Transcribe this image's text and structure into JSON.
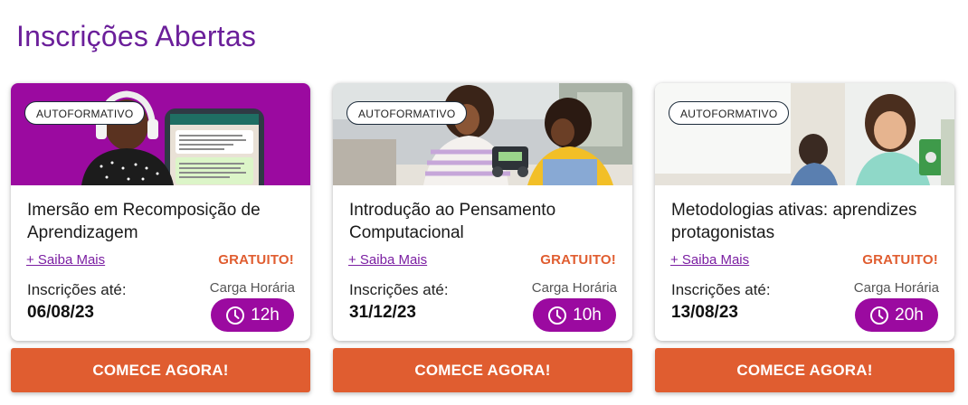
{
  "section": {
    "title": "Inscrições Abertas"
  },
  "colors": {
    "title": "#6b1f9a",
    "accent": "#e05d30",
    "pill": "#9b0aa0",
    "link": "#7b1fa2"
  },
  "cards": [
    {
      "badge": "AUTOFORMATIVO",
      "title": "Imersão em Recomposição de Aprendizagem",
      "more_link": "+ Saiba Mais",
      "price": "GRATUITO!",
      "deadline_label": "Inscrições até:",
      "deadline_date": "06/08/23",
      "hours_label": "Carga Horária",
      "hours": "12h",
      "cta": "COMECE AGORA!",
      "image": "woman-headphones-phone-chat"
    },
    {
      "badge": "AUTOFORMATIVO",
      "title": "Introdução ao Pensamento Computacional",
      "more_link": "+ Saiba Mais",
      "price": "GRATUITO!",
      "deadline_label": "Inscrições até:",
      "deadline_date": "31/12/23",
      "hours_label": "Carga Horária",
      "hours": "10h",
      "cta": "COMECE AGORA!",
      "image": "kids-building-robot"
    },
    {
      "badge": "AUTOFORMATIVO",
      "title": "Metodologias ativas: aprendizes protagonistas",
      "more_link": "+ Saiba Mais",
      "price": "GRATUITO!",
      "deadline_label": "Inscrições até:",
      "deadline_date": "13/08/23",
      "hours_label": "Carga Horária",
      "hours": "20h",
      "cta": "COMECE AGORA!",
      "image": "girl-smiling-classroom"
    }
  ]
}
